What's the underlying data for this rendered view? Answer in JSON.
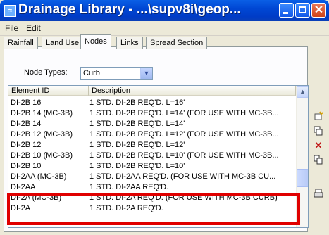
{
  "window": {
    "title": "Drainage Library - ...\\supv8i\\geop...",
    "app_icon": "drainage-app-icon",
    "controls": {
      "minimize_icon": "minimize-icon",
      "maximize_icon": "maximize-icon",
      "close": "✕"
    }
  },
  "menubar": {
    "items": [
      {
        "label": "File",
        "mnemonic": "F",
        "rest": "ile"
      },
      {
        "label": "Edit",
        "mnemonic": "E",
        "rest": "dit"
      }
    ]
  },
  "tabs": [
    "Rainfall",
    "Land Use",
    "Nodes",
    "Links",
    "Spread Section"
  ],
  "active_tab": "Nodes",
  "node_types": {
    "label": "Node Types:",
    "value": "Curb"
  },
  "table": {
    "headers": [
      "Element ID",
      "Description"
    ],
    "rows": [
      {
        "id": "DI-2B 16",
        "desc": "1 STD. DI-2B REQ'D. L=16'"
      },
      {
        "id": "DI-2B 14 (MC-3B)",
        "desc": "1 STD. DI-2B REQ'D. L=14'  (FOR USE WITH MC-3B..."
      },
      {
        "id": "DI-2B 14",
        "desc": "1 STD. DI-2B REQ'D. L=14'"
      },
      {
        "id": "DI-2B 12 (MC-3B)",
        "desc": "1 STD. DI-2B REQ'D. L=12'  (FOR USE WITH MC-3B..."
      },
      {
        "id": "DI-2B 12",
        "desc": "1 STD. DI-2B REQ'D. L=12'"
      },
      {
        "id": "DI-2B 10 (MC-3B)",
        "desc": "1 STD. DI-2B REQ'D. L=10'  (FOR USE WITH MC-3B..."
      },
      {
        "id": "DI-2B 10",
        "desc": "1 STD. DI-2B REQ'D. L=10'"
      },
      {
        "id": "DI-2AA (MC-3B)",
        "desc": "1 STD. DI-2AA REQ'D.  (FOR USE WITH MC-3B CU..."
      },
      {
        "id": "DI-2AA",
        "desc": "1 STD. DI-2AA REQ'D."
      },
      {
        "id": "DI-2A (MC-3B)",
        "desc": "1 STD. DI-2A REQ'D.  (FOR USE WITH MC-3B CURB)"
      },
      {
        "id": "DI-2A",
        "desc": "1 STD. DI-2A REQ'D."
      }
    ]
  },
  "side_toolbar": [
    "new-item-icon",
    "copy-icon",
    "delete-icon",
    "paste-icon",
    "print-icon"
  ],
  "colors": {
    "title_bar": "#0047d4",
    "highlight": "#e00000",
    "delete": "#c01818"
  }
}
